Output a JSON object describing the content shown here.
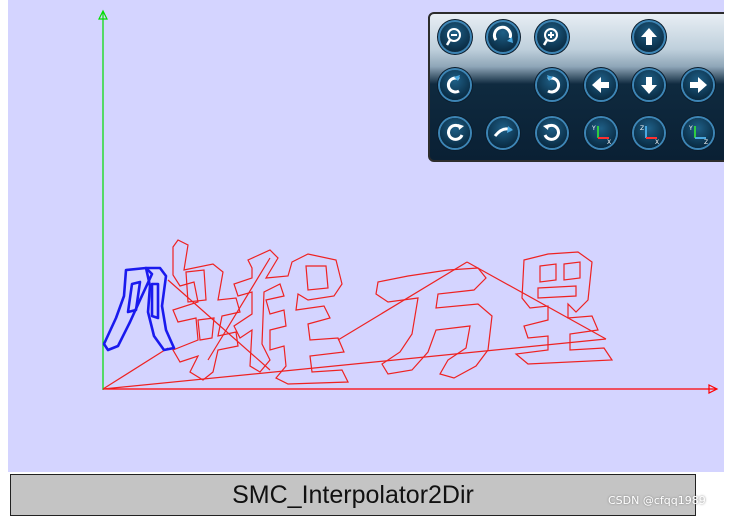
{
  "app": {
    "title": "SMC_Interpolator2Dir"
  },
  "watermark": "CSDN @cfqq1989",
  "viewport": {
    "background": "#d4d4ff",
    "axis_colors": {
      "x": "#ff0000",
      "y": "#00dd00"
    },
    "path_colors": {
      "toolpath": "#ee2222",
      "current": "#1a1aee"
    }
  },
  "toolbar": {
    "buttons": [
      {
        "name": "zoom-out-button",
        "icon": "zoom-out-icon"
      },
      {
        "name": "rotate-view-button",
        "icon": "rotate-view-icon"
      },
      {
        "name": "zoom-in-button",
        "icon": "zoom-in-icon"
      },
      {
        "name": "pan-up-button",
        "icon": "arrow-up-icon"
      },
      {
        "name": "rotate-left-button",
        "icon": "rotate-left-icon"
      },
      {
        "name": "rotate-right-button",
        "icon": "rotate-right-icon"
      },
      {
        "name": "pan-left-button",
        "icon": "arrow-left-icon"
      },
      {
        "name": "pan-down-button",
        "icon": "arrow-down-icon"
      },
      {
        "name": "pan-right-button",
        "icon": "arrow-right-icon"
      },
      {
        "name": "rotate-ccw-button",
        "icon": "rotate-ccw-icon"
      },
      {
        "name": "tilt-button",
        "icon": "tilt-icon"
      },
      {
        "name": "rotate-cw-button",
        "icon": "rotate-cw-icon"
      },
      {
        "name": "view-xy-button",
        "icon": "axes-xy-icon",
        "label": "Y X"
      },
      {
        "name": "view-zx-button",
        "icon": "axes-zx-icon",
        "label": "Z X"
      },
      {
        "name": "view-yz-button",
        "icon": "axes-yz-icon",
        "label": "Y Z"
      }
    ]
  }
}
